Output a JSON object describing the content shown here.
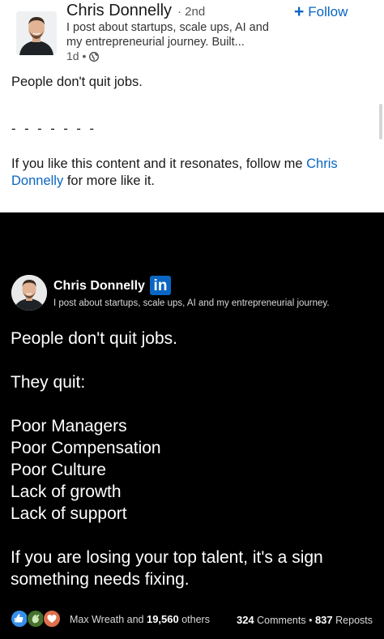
{
  "post": {
    "author_name": "Chris Donnelly",
    "degree": "· 2nd",
    "headline": "I post about startups, scale ups, AI and my entrepreneurial journey. Built...",
    "time_ago": "1d •",
    "visibility_icon": "globe-icon",
    "follow_label": "Follow",
    "follow_icon": "+",
    "text_line": "People don't quit jobs.",
    "divider": "- - - - - - -",
    "cta_prefix": "If you like this content and it resonates, follow me",
    "cta_mention": "Chris Donnelly",
    "cta_suffix": "for more like it."
  },
  "card": {
    "name": "Chris Donnelly",
    "brand_badge": "in",
    "headline": "I post about startups, scale ups, AI and my entrepreneurial journey.",
    "lines": [
      "People don't quit jobs.",
      "They quit:",
      "Poor Managers",
      "Poor Compensation",
      "Poor Culture",
      "Lack of growth",
      "Lack of support",
      "If you are losing your top talent, it's a sign",
      "something needs fixing."
    ]
  },
  "social": {
    "reaction_icons": [
      "like-icon",
      "clap-icon",
      "love-icon"
    ],
    "reactor_name": "Max Wreath and",
    "reaction_count": "19,560",
    "reaction_suffix": "others",
    "comments_count": "324",
    "comments_label": "Comments",
    "separator": "•",
    "reposts_count": "837",
    "reposts_label": "Reposts"
  },
  "colors": {
    "link_blue": "#0a66c2",
    "card_background": "#000000",
    "like_blue": "#378fe9",
    "clap_green": "#44712e",
    "love_orange": "#df704d"
  }
}
